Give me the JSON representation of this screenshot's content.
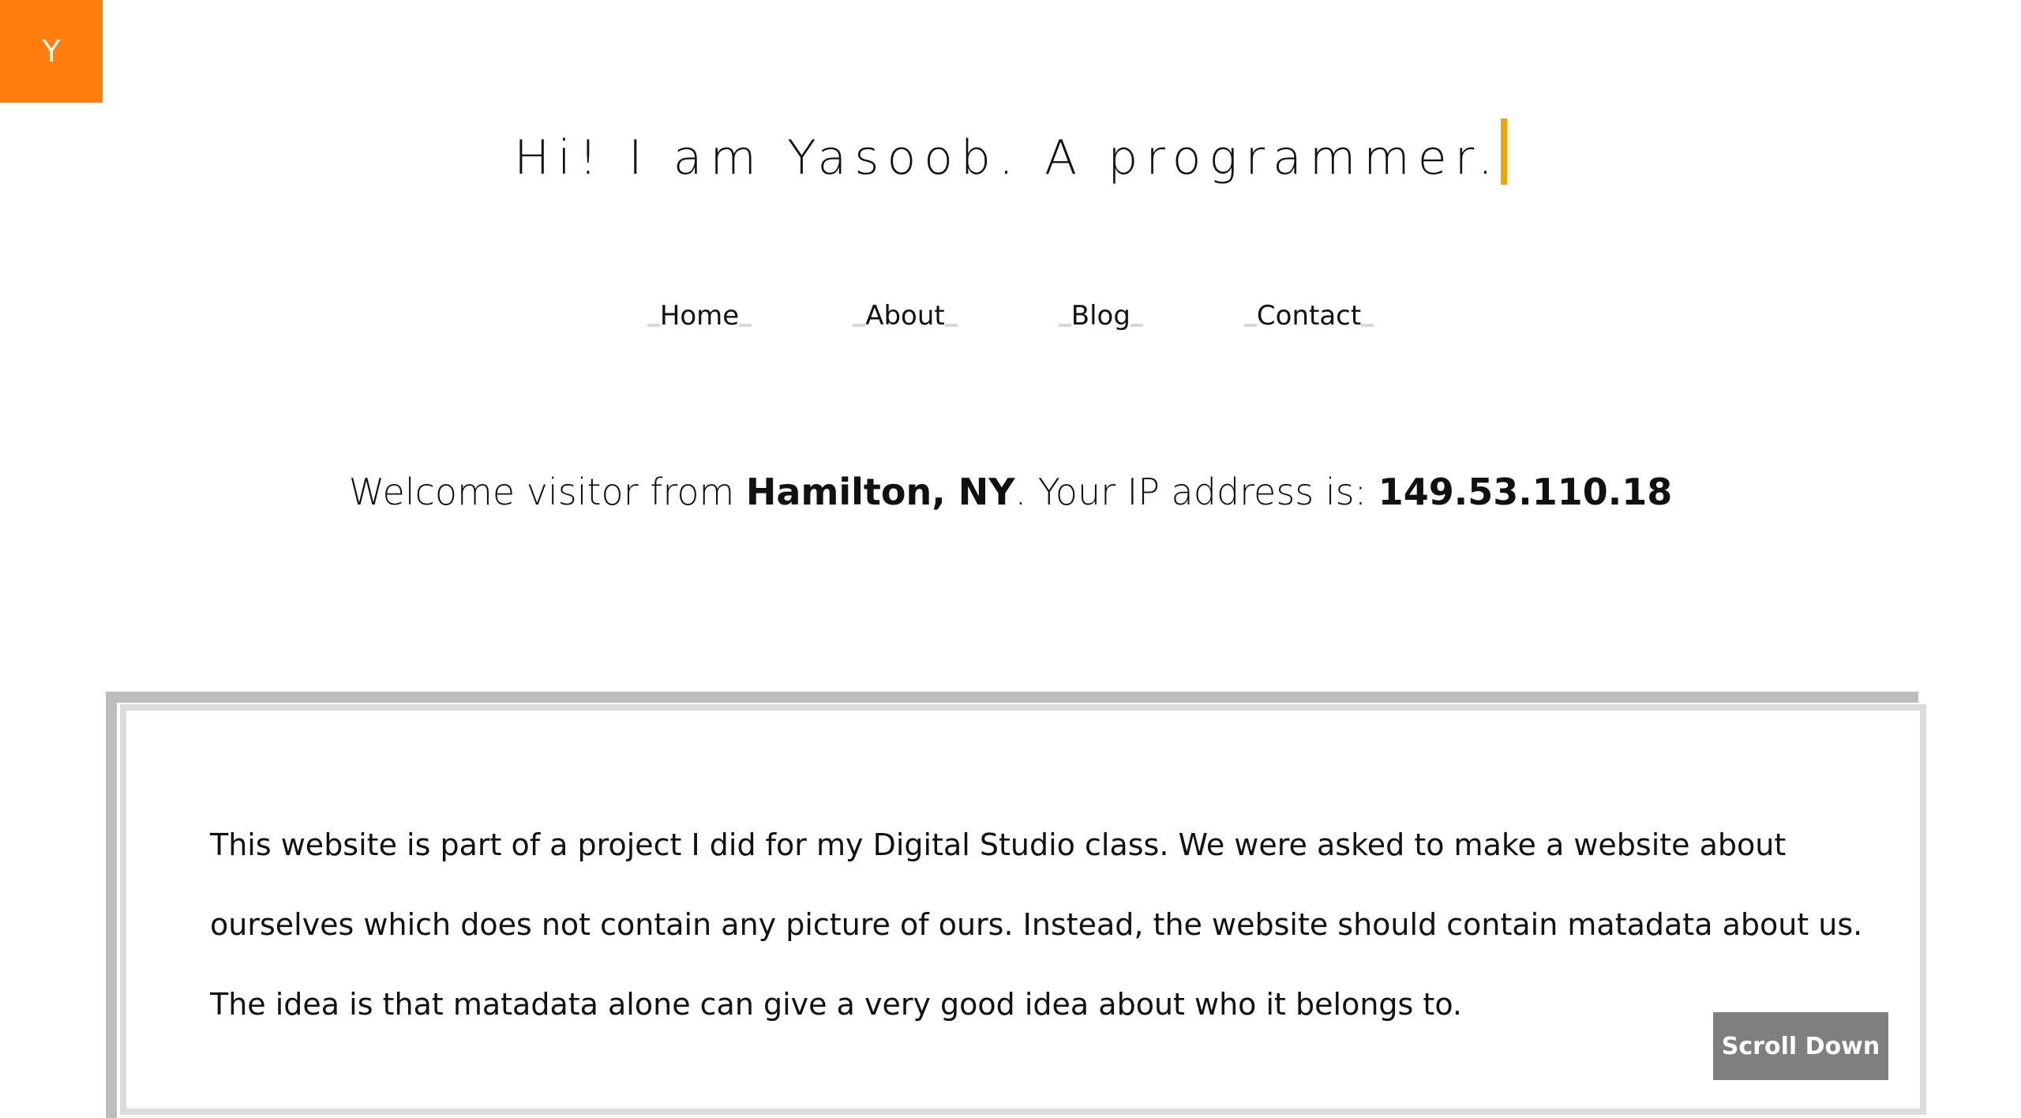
{
  "logo": {
    "letter": "Y",
    "color": "#ff7f0e"
  },
  "headline": {
    "text": "Hi! I am Yasoob. A programmer.",
    "cursor_color": "#f0a500"
  },
  "nav": {
    "items": [
      {
        "label": "Home"
      },
      {
        "label": "About"
      },
      {
        "label": "Blog"
      },
      {
        "label": "Contact"
      }
    ]
  },
  "welcome": {
    "prefix": "Welcome visitor from ",
    "location": "Hamilton, NY",
    "middle": ". Your IP address is: ",
    "ip": "149.53.110.18"
  },
  "card": {
    "text": "This website is part of a project I did for my Digital Studio class. We were asked to make a website about ourselves which does not contain any picture of ours. Instead, the website should contain matadata about us. The idea is that matadata alone can give a very good idea about who it belongs to."
  },
  "scroll_button": {
    "label": "Scroll Down",
    "color": "#7f7f7f"
  }
}
